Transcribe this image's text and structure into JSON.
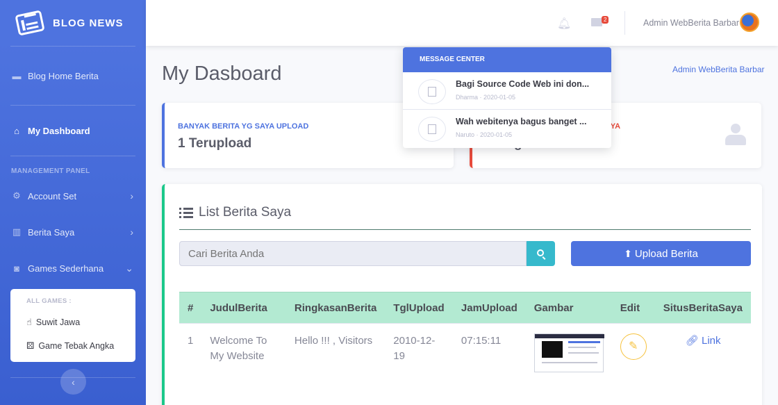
{
  "brand": {
    "name": "BLOG NEWS"
  },
  "sidebar": {
    "home": "Blog Home Berita",
    "dashboard": "My Dashboard",
    "management_heading": "MANAGEMENT PANEL",
    "items": [
      {
        "label": "Account Set",
        "icon": "gear-icon"
      },
      {
        "label": "Berita Saya",
        "icon": "chart-icon"
      },
      {
        "label": "Games Sederhana",
        "icon": "gamepad-icon"
      }
    ],
    "games_heading": "ALL GAMES :",
    "games": [
      {
        "label": "Suwit Jawa",
        "icon": "hand-pointer-icon"
      },
      {
        "label": "Game Tebak Angka",
        "icon": "dice-icon"
      }
    ]
  },
  "topbar": {
    "mail_badge": "2",
    "user_name": "Admin WebBerita Barbar"
  },
  "page": {
    "title": "My Dasboard",
    "crumb_user": "Admin WebBerita Barbar"
  },
  "cards": [
    {
      "label": "BANYAK BERITA YG SAYA UPLOAD",
      "value": "1 Terupload"
    },
    {
      "label": "TA SAYA",
      "value": "g"
    }
  ],
  "list": {
    "title": "List Berita Saya",
    "search_placeholder": "Cari Berita Anda",
    "upload_label": "Upload Berita",
    "columns": [
      "#",
      "JudulBerita",
      "RingkasanBerita",
      "TglUpload",
      "JamUpload",
      "Gambar",
      "Edit",
      "SitusBeritaSaya"
    ],
    "rows": [
      {
        "no": "1",
        "judul": "Welcome To My Website",
        "ringkasan": "Hello !!! , Visitors",
        "tgl": "2010-12-19",
        "jam": "07:15:11",
        "link": "Link"
      }
    ]
  },
  "messages": {
    "header": "MESSAGE CENTER",
    "items": [
      {
        "title": "Bagi Source Code Web ini don...",
        "meta": "Dharma · 2020-01-05"
      },
      {
        "title": "Wah webitenya bagus banget ...",
        "meta": "Naruto · 2020-01-05"
      }
    ]
  },
  "colors": {
    "primary": "#4e73df",
    "success": "#1cc88a",
    "danger": "#e74a3b",
    "info": "#36b9cc",
    "warning": "#f6c23e"
  }
}
